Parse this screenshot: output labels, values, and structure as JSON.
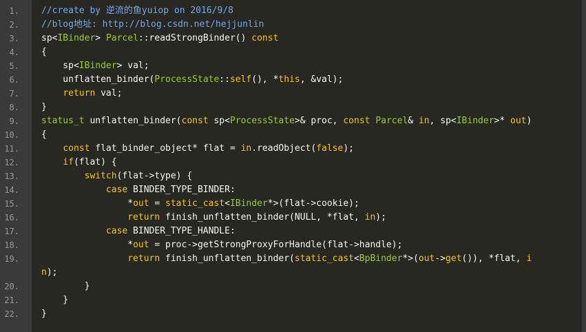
{
  "editor": {
    "colors": {
      "background": "#272822",
      "gutter": "#3a3a3a",
      "line_number": "#9a9a9a",
      "comment": "#75a8e8",
      "keyword": "#f5c518",
      "type": "#9ccc2e",
      "plain": "#f8f8f2"
    },
    "lines": [
      {
        "n": "1.",
        "tokens": [
          {
            "t": "//create by 逆流的鱼yuiop on 2016/9/8",
            "c": "comment"
          }
        ]
      },
      {
        "n": "2.",
        "tokens": [
          {
            "t": "//blog地址: http://blog.csdn.net/hejjunlin",
            "c": "comment"
          }
        ]
      },
      {
        "n": "3.",
        "tokens": [
          {
            "t": "sp<",
            "c": "plain"
          },
          {
            "t": "IBinder",
            "c": "type"
          },
          {
            "t": "> ",
            "c": "plain"
          },
          {
            "t": "Parcel",
            "c": "type"
          },
          {
            "t": "::readStrongBinder() ",
            "c": "plain"
          },
          {
            "t": "const",
            "c": "kw"
          }
        ]
      },
      {
        "n": "4.",
        "tokens": [
          {
            "t": "{",
            "c": "plain"
          }
        ]
      },
      {
        "n": "5.",
        "tokens": [
          {
            "t": "    sp<",
            "c": "plain"
          },
          {
            "t": "IBinder",
            "c": "type"
          },
          {
            "t": "> val;",
            "c": "plain"
          }
        ]
      },
      {
        "n": "6.",
        "tokens": [
          {
            "t": "    unflatten_binder(",
            "c": "plain"
          },
          {
            "t": "ProcessState",
            "c": "type"
          },
          {
            "t": "::",
            "c": "plain"
          },
          {
            "t": "self",
            "c": "kw"
          },
          {
            "t": "(), *",
            "c": "plain"
          },
          {
            "t": "this",
            "c": "kw"
          },
          {
            "t": ", &val);",
            "c": "plain"
          }
        ]
      },
      {
        "n": "7.",
        "tokens": [
          {
            "t": "    ",
            "c": "plain"
          },
          {
            "t": "return",
            "c": "kw"
          },
          {
            "t": " val;",
            "c": "plain"
          }
        ]
      },
      {
        "n": "8.",
        "tokens": [
          {
            "t": "}",
            "c": "plain"
          }
        ]
      },
      {
        "n": "9.",
        "tokens": [
          {
            "t": "status_t",
            "c": "type"
          },
          {
            "t": " unflatten_binder(",
            "c": "plain"
          },
          {
            "t": "const",
            "c": "kw"
          },
          {
            "t": " sp<",
            "c": "plain"
          },
          {
            "t": "ProcessState",
            "c": "type"
          },
          {
            "t": ">& proc, ",
            "c": "plain"
          },
          {
            "t": "const",
            "c": "kw"
          },
          {
            "t": " ",
            "c": "plain"
          },
          {
            "t": "Parcel",
            "c": "type"
          },
          {
            "t": "& ",
            "c": "plain"
          },
          {
            "t": "in",
            "c": "kw"
          },
          {
            "t": ", sp<",
            "c": "plain"
          },
          {
            "t": "IBinder",
            "c": "type"
          },
          {
            "t": ">* ",
            "c": "plain"
          },
          {
            "t": "out",
            "c": "kw"
          },
          {
            "t": ")",
            "c": "plain"
          }
        ]
      },
      {
        "n": "10.",
        "tokens": [
          {
            "t": "{",
            "c": "plain"
          }
        ]
      },
      {
        "n": "11.",
        "tokens": [
          {
            "t": "    ",
            "c": "plain"
          },
          {
            "t": "const",
            "c": "kw"
          },
          {
            "t": " flat_binder_object* flat = ",
            "c": "plain"
          },
          {
            "t": "in",
            "c": "kw"
          },
          {
            "t": ".readObject(",
            "c": "plain"
          },
          {
            "t": "false",
            "c": "kw"
          },
          {
            "t": ");",
            "c": "plain"
          }
        ]
      },
      {
        "n": "12.",
        "tokens": [
          {
            "t": "    ",
            "c": "plain"
          },
          {
            "t": "if",
            "c": "kw"
          },
          {
            "t": "(flat) {",
            "c": "plain"
          }
        ]
      },
      {
        "n": "13.",
        "tokens": [
          {
            "t": "        ",
            "c": "plain"
          },
          {
            "t": "switch",
            "c": "kw"
          },
          {
            "t": "(flat->type) {",
            "c": "plain"
          }
        ]
      },
      {
        "n": "14.",
        "tokens": [
          {
            "t": "            ",
            "c": "plain"
          },
          {
            "t": "case",
            "c": "kw"
          },
          {
            "t": " BINDER_TYPE_BINDER:",
            "c": "plain"
          }
        ]
      },
      {
        "n": "15.",
        "tokens": [
          {
            "t": "                *",
            "c": "plain"
          },
          {
            "t": "out",
            "c": "kw"
          },
          {
            "t": " = ",
            "c": "plain"
          },
          {
            "t": "static_cast",
            "c": "kw"
          },
          {
            "t": "<",
            "c": "plain"
          },
          {
            "t": "IBinder",
            "c": "type"
          },
          {
            "t": "*>(flat->cookie);",
            "c": "plain"
          }
        ]
      },
      {
        "n": "16.",
        "tokens": [
          {
            "t": "                ",
            "c": "plain"
          },
          {
            "t": "return",
            "c": "kw"
          },
          {
            "t": " finish_unflatten_binder(NULL, *flat, ",
            "c": "plain"
          },
          {
            "t": "in",
            "c": "kw"
          },
          {
            "t": ");",
            "c": "plain"
          }
        ]
      },
      {
        "n": "17.",
        "tokens": [
          {
            "t": "            ",
            "c": "plain"
          },
          {
            "t": "case",
            "c": "kw"
          },
          {
            "t": " BINDER_TYPE_HANDLE:",
            "c": "plain"
          }
        ]
      },
      {
        "n": "18.",
        "tokens": [
          {
            "t": "                *",
            "c": "plain"
          },
          {
            "t": "out",
            "c": "kw"
          },
          {
            "t": " = proc->getStrongProxyForHandle(flat->handle);",
            "c": "plain"
          }
        ]
      },
      {
        "n": "19.",
        "wrap": true,
        "tokens": [
          {
            "t": "                ",
            "c": "plain"
          },
          {
            "t": "return",
            "c": "kw"
          },
          {
            "t": " finish_unflatten_binder(",
            "c": "plain"
          },
          {
            "t": "static_cast",
            "c": "kw"
          },
          {
            "t": "<",
            "c": "plain"
          },
          {
            "t": "BpBinder",
            "c": "type"
          },
          {
            "t": "*>(",
            "c": "plain"
          },
          {
            "t": "out",
            "c": "kw"
          },
          {
            "t": "->",
            "c": "plain"
          },
          {
            "t": "get",
            "c": "kw"
          },
          {
            "t": "()), *flat, ",
            "c": "plain"
          },
          {
            "t": "i",
            "c": "kw"
          },
          {
            "t": "\n",
            "c": "plain"
          },
          {
            "t": "n",
            "c": "kw"
          },
          {
            "t": ");",
            "c": "plain"
          }
        ]
      },
      {
        "n": "20.",
        "tokens": [
          {
            "t": "        }",
            "c": "plain"
          }
        ]
      },
      {
        "n": "21.",
        "tokens": [
          {
            "t": "    }",
            "c": "plain"
          }
        ]
      },
      {
        "n": "22.",
        "tokens": [
          {
            "t": "}",
            "c": "plain"
          }
        ]
      }
    ]
  }
}
